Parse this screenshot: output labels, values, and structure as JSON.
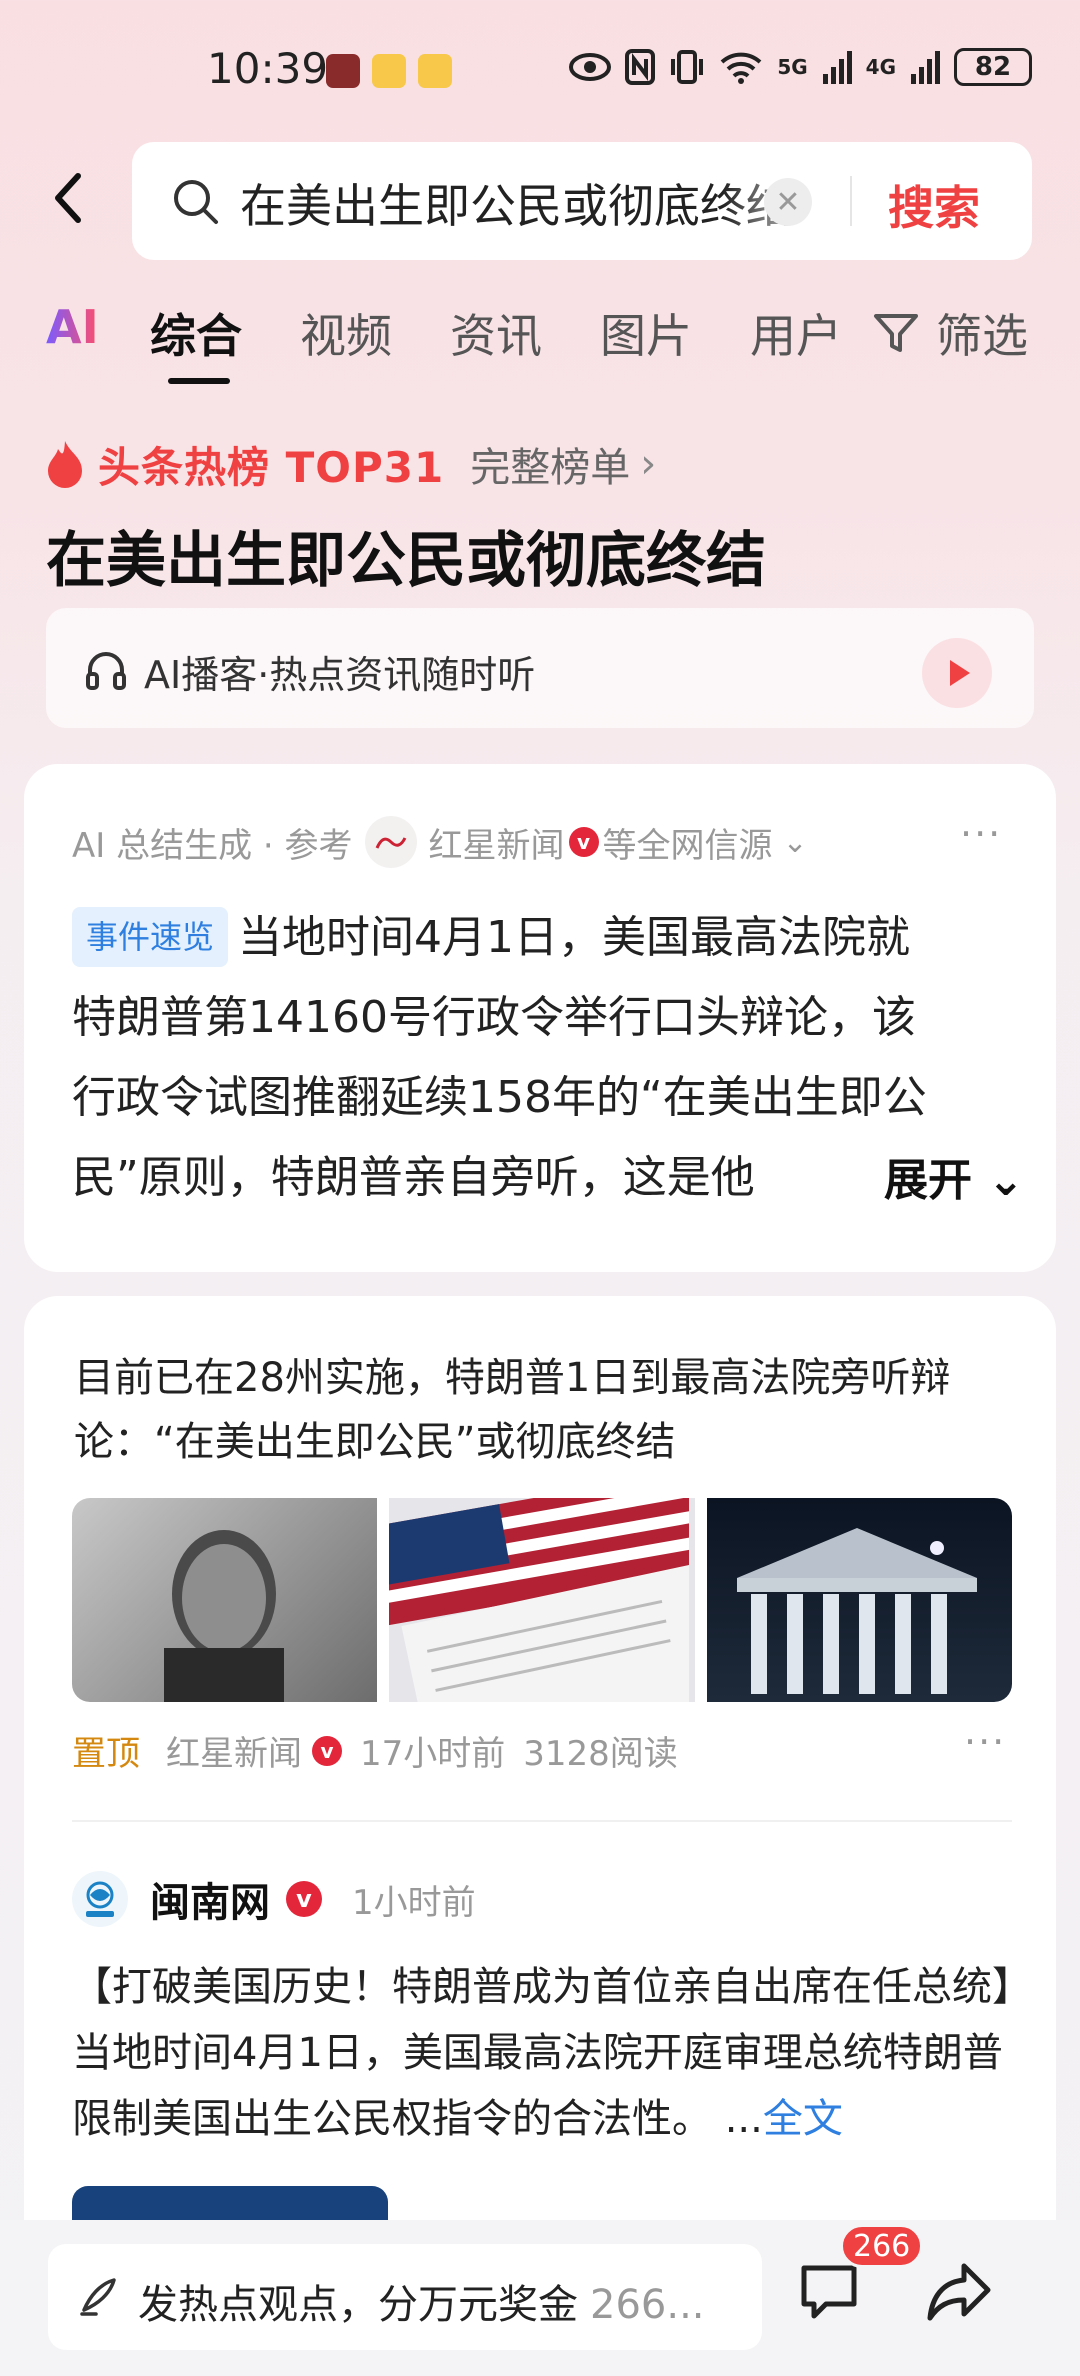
{
  "status_bar": {
    "time": "10:39",
    "battery": "82",
    "net1": "5G",
    "net2": "4G"
  },
  "search": {
    "query": "在美出生即公民或彻底终结",
    "button": "搜索"
  },
  "tabs": [
    {
      "label": "AI"
    },
    {
      "label": "综合"
    },
    {
      "label": "视频"
    },
    {
      "label": "资讯"
    },
    {
      "label": "图片"
    },
    {
      "label": "用户"
    },
    {
      "label": "筛选"
    }
  ],
  "hot_board": {
    "label": "头条热榜 TOP31",
    "full_list": "完整榜单",
    "topic_title": "在美出生即公民或彻底终结",
    "podcast": "AI播客·热点资讯随时听"
  },
  "ai_summary": {
    "meta_prefix": "AI 总结生成 · 参考",
    "source": "红星新闻",
    "meta_suffix": "等全网信源",
    "tag": "事件速览",
    "line1": "当地时间4月1日，美国最高法院就",
    "line2": "特朗普第14160号行政令举行口头辩论，该",
    "line3": "行政令试图推翻延续158年的“在美出生即公",
    "line4": "民”原则，特朗普亲自旁听，这是他",
    "expand": "展开"
  },
  "news_item": {
    "title": "目前已在28州实施，特朗普1日到最高法院旁听辩论：“在美出生即公民”或彻底终结",
    "pin": "置顶",
    "source": "红星新闻",
    "time": "17小时前",
    "reads": "3128阅读"
  },
  "post": {
    "source": "闽南网",
    "time": "1小时前",
    "body": "【打破美国历史！特朗普成为首位亲自出席在任总统】当地时间4月1日，美国最高法院开庭审理总统特朗普限制美国出生公民权指令的合法性。",
    "ellipsis": "...",
    "fulltext": "全文"
  },
  "bottom_bar": {
    "placeholder": "发热点观点，分万元奖金",
    "inline_count": "266...",
    "comment_badge": "266"
  },
  "colors": {
    "accent_red": "#f04142",
    "link_blue": "#2e7fe0",
    "pin_gold": "#d4880f"
  }
}
